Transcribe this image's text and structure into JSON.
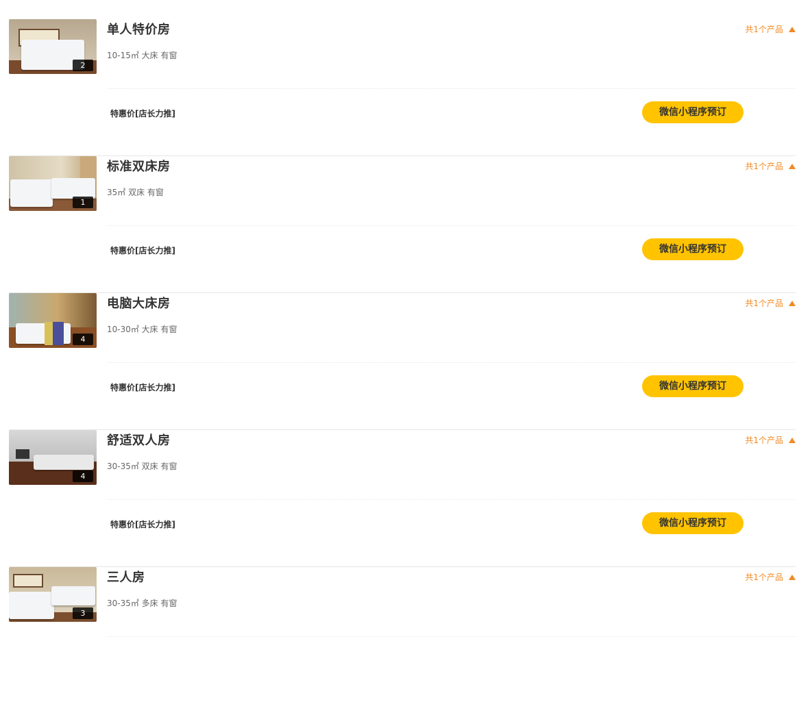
{
  "rooms": [
    {
      "name": "单人特价房",
      "spec": "10-15㎡ 大床 有窗",
      "photo_count": "2",
      "product_count": "共1个产品",
      "product_name": "特惠价[店长力推]",
      "book_label": "微信小程序预订"
    },
    {
      "name": "标准双床房",
      "spec": "35㎡ 双床 有窗",
      "photo_count": "1",
      "product_count": "共1个产品",
      "product_name": "特惠价[店长力推]",
      "book_label": "微信小程序预订"
    },
    {
      "name": "电脑大床房",
      "spec": "10-30㎡ 大床 有窗",
      "photo_count": "4",
      "product_count": "共1个产品",
      "product_name": "特惠价[店长力推]",
      "book_label": "微信小程序预订"
    },
    {
      "name": "舒适双人房",
      "spec": "30-35㎡ 双床 有窗",
      "photo_count": "4",
      "product_count": "共1个产品",
      "product_name": "特惠价[店长力推]",
      "book_label": "微信小程序预订"
    },
    {
      "name": "三人房",
      "spec": "30-35㎡ 多床 有窗",
      "photo_count": "3",
      "product_count": "共1个产品"
    }
  ],
  "colors": {
    "accent_orange": "#f08a24",
    "button_yellow": "#ffc300"
  },
  "icons": {
    "expand": "triangle-up-icon"
  }
}
